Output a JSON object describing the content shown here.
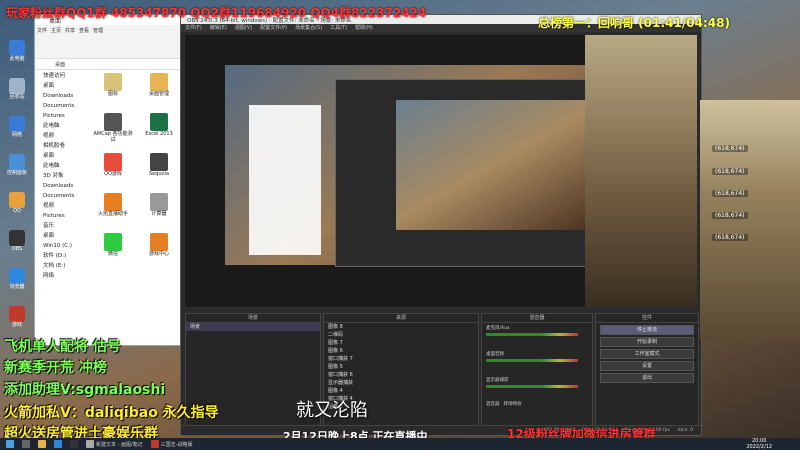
{
  "header": {
    "red_text": "玩家粉丝群QQ1群 485347870 QQ2群119684920 QQ4群822372424",
    "right_text": "总榜第一：回响哥  (01:41/04:48)"
  },
  "desktop_icons": [
    {
      "label": "此电脑",
      "color": "#3a7bd5"
    },
    {
      "label": "回收站",
      "color": "#9fb3c8"
    },
    {
      "label": "网络",
      "color": "#3a7bd5"
    },
    {
      "label": "控制面板",
      "color": "#4a90d9"
    },
    {
      "label": "QQ",
      "color": "#e9a23b"
    },
    {
      "label": "OBS",
      "color": "#333333"
    },
    {
      "label": "浏览器",
      "color": "#2e86de"
    },
    {
      "label": "游戏",
      "color": "#c0392b"
    }
  ],
  "explorer": {
    "title": "桌面",
    "ribbon": [
      "文件",
      "主页",
      "共享",
      "查看",
      "管理"
    ],
    "address": "桌面",
    "nav": [
      "快速访问",
      "桌面",
      "Downloads",
      "Documents",
      "Pictures",
      "此电脑",
      "视频",
      "相机胶卷",
      "桌面",
      "此电脑",
      "3D 对象",
      "Downloads",
      "Documents",
      "视频",
      "Pictures",
      "音乐",
      "桌面",
      "Win10 (C:)",
      "软件 (D:)",
      "文档 (E:)",
      "网络"
    ],
    "files": [
      {
        "name": "图标",
        "color": "#d9c27a"
      },
      {
        "name": "桌面管理",
        "color": "#e6b450"
      },
      {
        "name": "AMCap 各功能测试",
        "color": "#555"
      },
      {
        "name": "Excel 2013",
        "color": "#1e7145"
      },
      {
        "name": "QQ游戏",
        "color": "#e74c3c"
      },
      {
        "name": "Sequoia",
        "color": "#444"
      },
      {
        "name": "火焰直播助手",
        "color": "#e67e22"
      },
      {
        "name": "计算器",
        "color": "#999"
      },
      {
        "name": "微信",
        "color": "#2ecc40"
      },
      {
        "name": "游戏中心",
        "color": "#e67e22"
      }
    ]
  },
  "obs": {
    "title": "OBS 24.0.3 (64-bit, windows) - 配置文件: 未命名 - 场景: 未命名",
    "menu": [
      "文件(F)",
      "编辑(E)",
      "视图(V)",
      "配置文件(P)",
      "场景集合(S)",
      "工具(T)",
      "帮助(H)"
    ],
    "scenes_header": "场景",
    "sources_header": "来源",
    "mixer_header": "混音器",
    "controls_header": "控件",
    "scene_list": [
      "场景"
    ],
    "sources": [
      "图像 8",
      "二维码",
      "图像 7",
      "图像 6",
      "窗口捕获 7",
      "图像 5",
      "窗口捕获 6",
      "显示器捕获",
      "图像 4",
      "窗口捕获 4",
      "图像 3"
    ],
    "mixer": [
      "麦克风/Aux",
      "桌面音频",
      "显示器捕获"
    ],
    "controls": [
      "停止推流",
      "开始录制",
      "工作室模式",
      "设置",
      "退出"
    ],
    "tabs": [
      "混音器",
      "转场特效"
    ],
    "status": [
      "LIVE: 00:00:00",
      "REC: 00:00:00",
      "CPU: 4.2%, 30.00 fps",
      "kb/s: 0"
    ]
  },
  "game_scores": [
    "(618,674)",
    "(618,674)",
    "(618,674)",
    "(618,674)",
    "(618,674)"
  ],
  "promo": {
    "line1": "飞机单人配将 估号",
    "line2": "新赛季开荒 冲榜",
    "line3": "添加助理V:sgmalaoshi",
    "line4": "火箭加私V：daliqibao 永久指导",
    "line5": "超火送房管进土豪娱乐群"
  },
  "center": {
    "title": "就又沦陷",
    "live": "2月12日晚上8点  正在直播中",
    "red": "12级粉丝牌加微信进房管群"
  },
  "taskbar": {
    "items": [
      "",
      "",
      "",
      "",
      "",
      "",
      "新建文本 - 画图/笔记",
      "",
      "三国志-战略版"
    ],
    "time": "20:00",
    "date": "2022/2/12"
  }
}
